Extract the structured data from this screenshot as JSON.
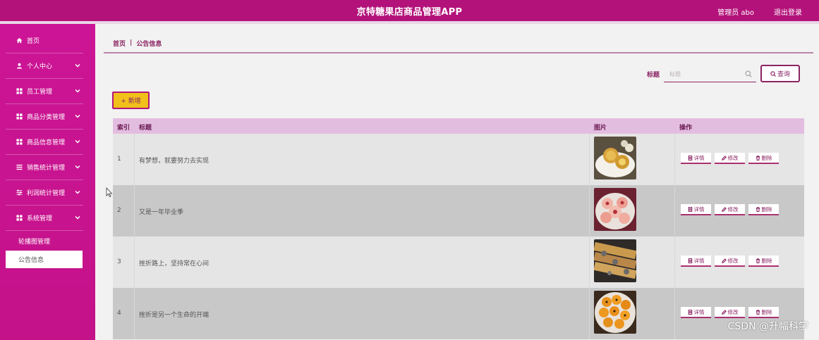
{
  "app": {
    "title": "京特糖果店商品管理APP",
    "user_label": "管理员 abo",
    "logout_label": "退出登录"
  },
  "sidebar": {
    "items": [
      {
        "label": "首页",
        "icon": "home-icon"
      },
      {
        "label": "个人中心",
        "icon": "user-icon"
      },
      {
        "label": "员工管理",
        "icon": "grid-icon"
      },
      {
        "label": "商品分类管理",
        "icon": "grid-icon"
      },
      {
        "label": "商品信息管理",
        "icon": "grid-icon"
      },
      {
        "label": "销售统计管理",
        "icon": "list-icon"
      },
      {
        "label": "利润统计管理",
        "icon": "sliders-icon"
      },
      {
        "label": "系统管理",
        "icon": "grid-icon"
      }
    ],
    "sub_items": [
      {
        "label": "轮播图管理"
      },
      {
        "label": "公告信息",
        "active": true
      }
    ]
  },
  "breadcrumb": {
    "home": "首页",
    "separator": "|",
    "current": "公告信息"
  },
  "search": {
    "label": "标题",
    "placeholder": "标题",
    "button_label": "查询"
  },
  "toolbar": {
    "add_label": "+ 新增"
  },
  "table": {
    "headers": {
      "index": "索引",
      "title": "标题",
      "image": "图片",
      "actions": "操作"
    },
    "rows": [
      {
        "index": "1",
        "title": "有梦想，就要努力去实现",
        "image": "tart-pastry"
      },
      {
        "index": "2",
        "title": "又是一年毕业季",
        "image": "peach-buns"
      },
      {
        "index": "3",
        "title": "挫折路上，坚持常在心间",
        "image": "egg-rolls"
      },
      {
        "index": "4",
        "title": "挫折是另一个生命的开端",
        "image": "egg-yolk-pastry"
      }
    ],
    "action_labels": {
      "detail": "详情",
      "edit": "修改",
      "delete": "删除"
    }
  },
  "watermark": "CSDN @升幅科学",
  "colors": {
    "topbar": "#b3127a",
    "sidebar": "#cc1596",
    "accent": "#8b2464",
    "header_row": "#e3bde0",
    "add_button": "#f2c01a"
  }
}
